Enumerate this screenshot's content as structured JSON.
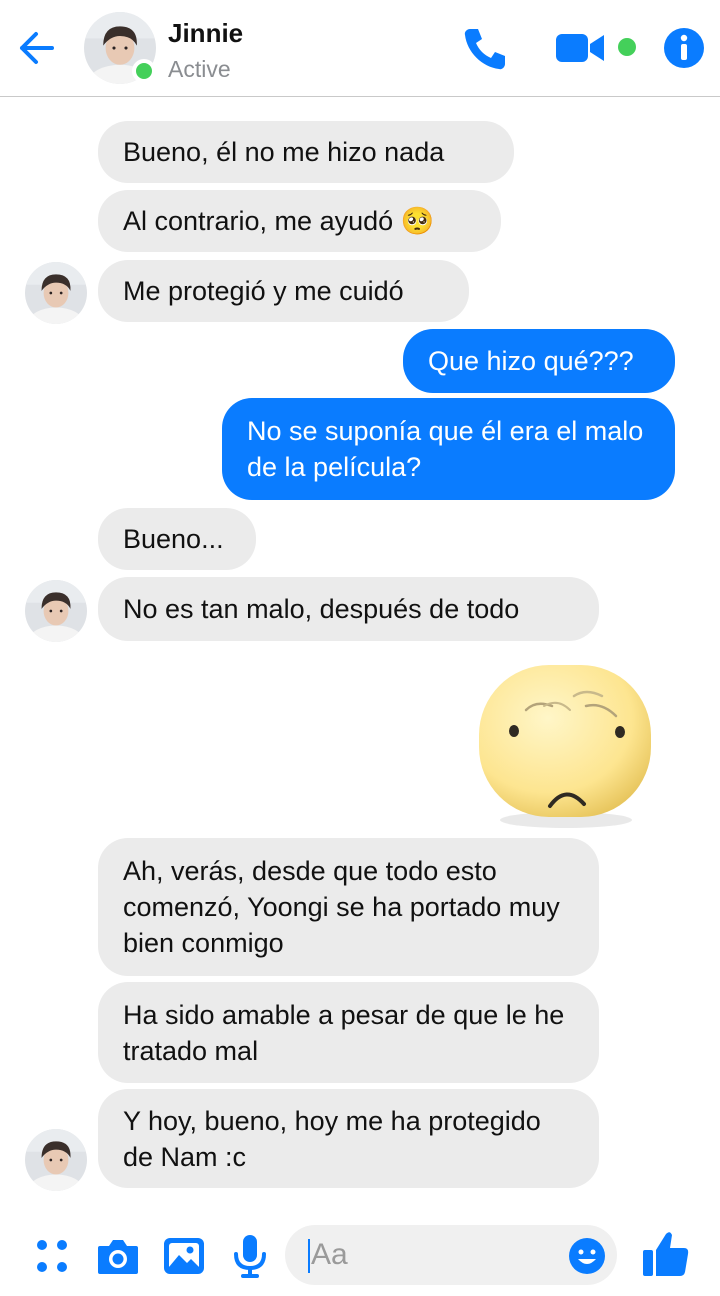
{
  "header": {
    "name": "Jinnie",
    "status": "Active"
  },
  "messages": [
    {
      "side": "in",
      "text": "Bueno, él no me hizo nada"
    },
    {
      "side": "in",
      "text": "Al contrario, me ayudó 🥺"
    },
    {
      "side": "in",
      "text": "Me protegió y me cuidó"
    },
    {
      "side": "out",
      "text": "Que hizo qué???"
    },
    {
      "side": "out",
      "text": "No se suponía que él era el malo de la película?"
    },
    {
      "side": "in",
      "text": "Bueno..."
    },
    {
      "side": "in",
      "text": "No es tan malo, después de todo"
    },
    {
      "side": "out",
      "type": "sticker",
      "icon": "worried-face-sticker"
    },
    {
      "side": "in",
      "text": "Ah, verás, desde que todo esto comenzó, Yoongi se ha portado muy bien conmigo"
    },
    {
      "side": "in",
      "text": "Ha sido amable a pesar de que le he tratado mal"
    },
    {
      "side": "in",
      "text": "Y hoy, bueno, hoy me ha protegido de Nam :c"
    }
  ],
  "composer": {
    "placeholder": "Aa",
    "icons": [
      "menu-dots-icon",
      "camera-icon",
      "image-icon",
      "microphone-icon",
      "emoji-icon",
      "thumbs-up-icon"
    ]
  },
  "colors": {
    "accent": "#0a7cff",
    "incoming_bubble": "#ebebeb",
    "online": "#44d05a"
  }
}
